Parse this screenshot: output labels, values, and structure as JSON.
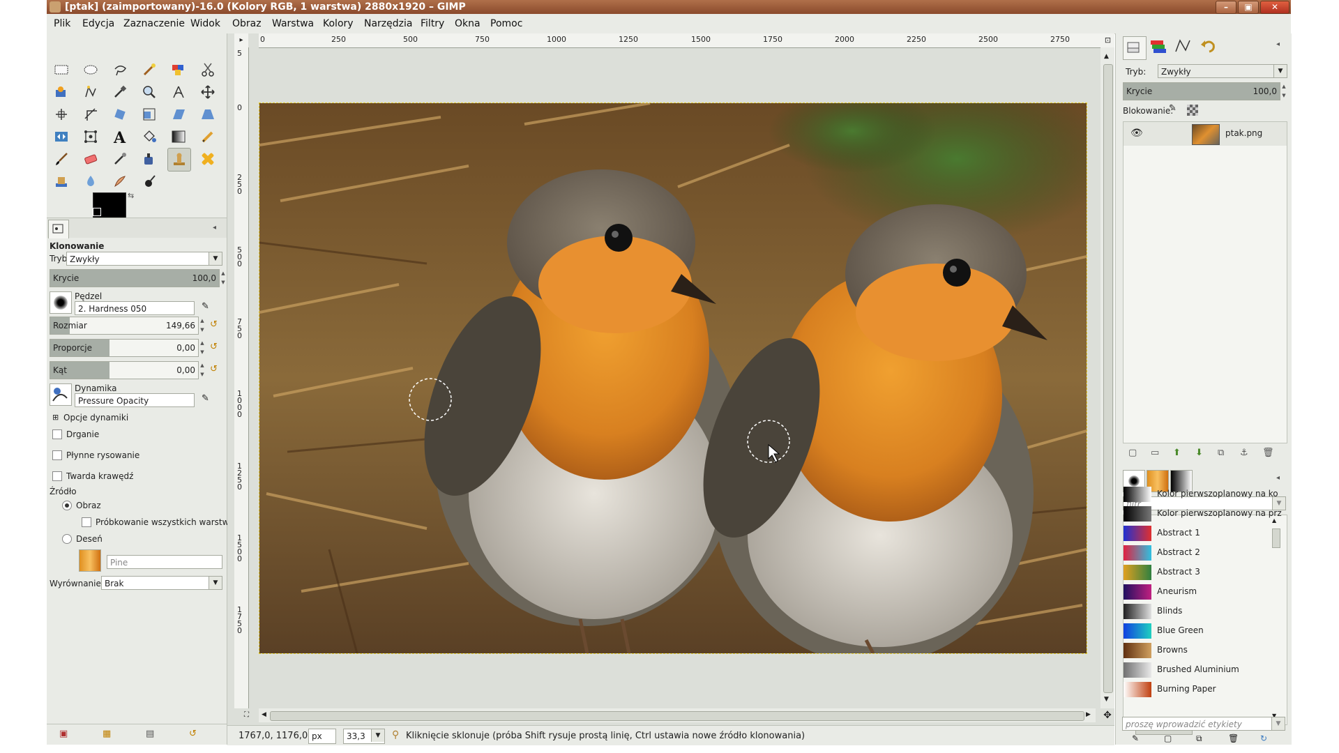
{
  "window": {
    "title": "[ptak] (zaimportowany)-16.0 (Kolory RGB, 1 warstwa) 2880x1920 – GIMP"
  },
  "menu": [
    "Plik",
    "Edycja",
    "Zaznaczenie",
    "Widok",
    "Obraz",
    "Warstwa",
    "Kolory",
    "Narzędzia",
    "Filtry",
    "Okna",
    "Pomoc"
  ],
  "tool_options": {
    "tool_name": "Klonowanie",
    "mode_label": "Tryb:",
    "mode_value": "Zwykły",
    "opacity_label": "Krycie",
    "opacity_value": "100,0",
    "brush_label": "Pędzel",
    "brush_value": "2. Hardness 050",
    "size_label": "Rozmiar",
    "size_value": "149,66",
    "aspect_label": "Proporcje",
    "aspect_value": "0,00",
    "angle_label": "Kąt",
    "angle_value": "0,00",
    "dynamics_label": "Dynamika",
    "dynamics_value": "Pressure Opacity",
    "dynamics_options": "Opcje dynamiki",
    "jitter": "Drganie",
    "smooth": "Płynne rysowanie",
    "hard_edge": "Twarda krawędź",
    "source_label": "Źródło",
    "source_image": "Obraz",
    "sample_merged": "Próbkowanie wszystkich warstw",
    "source_pattern": "Deseń",
    "pattern_name": "Pine",
    "alignment_label": "Wyrównanie:",
    "alignment_value": "Brak"
  },
  "ruler": {
    "h_ticks": [
      "0",
      "250",
      "500",
      "750",
      "1000",
      "1250",
      "1500",
      "1750",
      "2000",
      "2250",
      "2500",
      "2750"
    ],
    "v_ticks": [
      "5",
      "0",
      "2\n5\n0",
      "5\n0\n0",
      "7\n5\n0",
      "1\n0\n0\n0",
      "1\n2\n5\n0",
      "1\n5\n0\n0",
      "1\n7\n5\n0"
    ]
  },
  "status": {
    "coords": "1767,0, 1176,0",
    "unit": "px",
    "zoom": "33,3",
    "message": "Kliknięcie sklonuje (próba Shift rysuje prostą linię, Ctrl ustawia nowe źródło klonowania)"
  },
  "layers": {
    "mode_label": "Tryb:",
    "mode_value": "Zwykły",
    "opacity_label": "Krycie",
    "opacity_value": "100,0",
    "lock_label": "Blokowanie:",
    "layer_name": "ptak.png"
  },
  "gradients": {
    "filter_placeholder": "filtr",
    "tag_placeholder": "proszę wprowadzić etykiety",
    "items": [
      {
        "name": "Kolor pierwszoplanowy na ko",
        "c1": "#000000",
        "c2": "#ffffff"
      },
      {
        "name": "Kolor pierwszoplanowy na prz",
        "c1": "#000000",
        "c2": "#777777"
      },
      {
        "name": "Abstract 1",
        "c1": "#2030d0",
        "c2": "#e03030"
      },
      {
        "name": "Abstract 2",
        "c1": "#e02040",
        "c2": "#30c0e0"
      },
      {
        "name": "Abstract 3",
        "c1": "#e0a020",
        "c2": "#308040"
      },
      {
        "name": "Aneurism",
        "c1": "#201060",
        "c2": "#c02080"
      },
      {
        "name": "Blinds",
        "c1": "#202020",
        "c2": "#e0e0e0"
      },
      {
        "name": "Blue Green",
        "c1": "#1040e0",
        "c2": "#20d0c0"
      },
      {
        "name": "Browns",
        "c1": "#603010",
        "c2": "#d0a060"
      },
      {
        "name": "Brushed Aluminium",
        "c1": "#707070",
        "c2": "#e8e8e8"
      },
      {
        "name": "Burning Paper",
        "c1": "#ffffff",
        "c2": "#c04010"
      }
    ]
  }
}
